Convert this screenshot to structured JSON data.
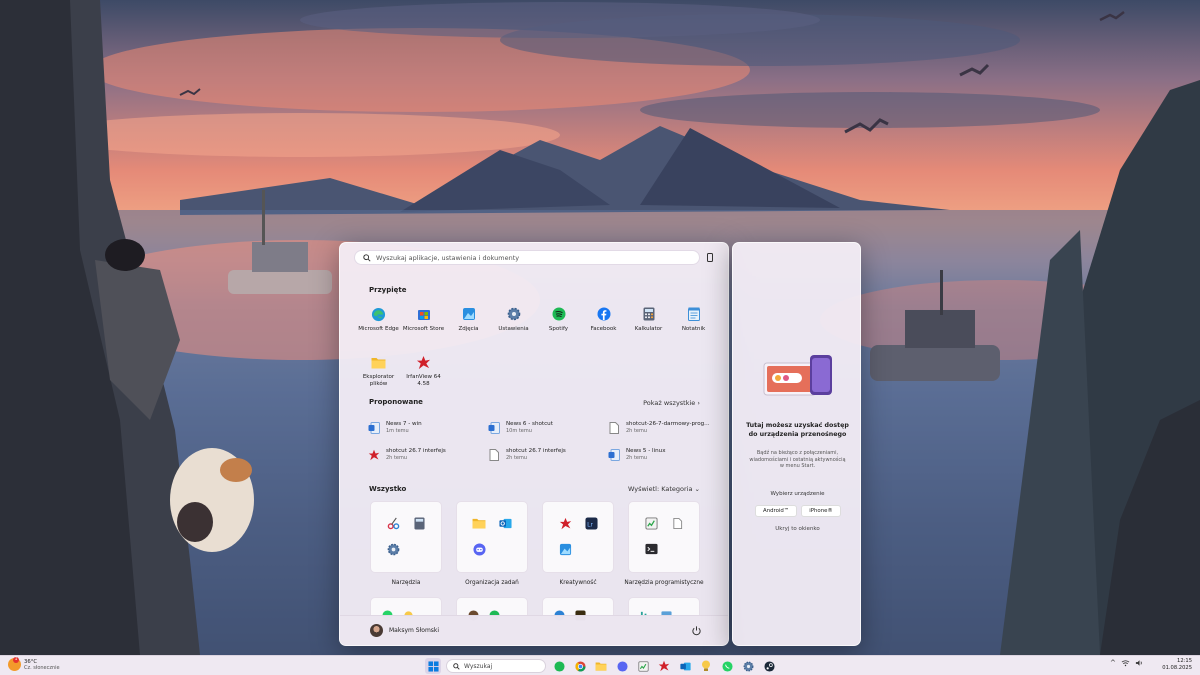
{
  "start_menu": {
    "search_placeholder": "Wyszukaj aplikacje, ustawienia i dokumenty",
    "pinned_title": "Przypięte",
    "pinned": [
      {
        "label": "Microsoft Edge",
        "icon": "edge-icon"
      },
      {
        "label": "Microsoft Store",
        "icon": "store-icon"
      },
      {
        "label": "Zdjęcia",
        "icon": "photos-icon"
      },
      {
        "label": "Ustawienia",
        "icon": "settings-icon"
      },
      {
        "label": "Spotify",
        "icon": "spotify-icon"
      },
      {
        "label": "Facebook",
        "icon": "facebook-icon"
      },
      {
        "label": "Kalkulator",
        "icon": "calculator-icon"
      },
      {
        "label": "Notatnik",
        "icon": "notepad-icon"
      },
      {
        "label": "Eksplorator plików",
        "icon": "folder-icon"
      },
      {
        "label": "IrfanView 64 4.58",
        "icon": "irfanview-icon"
      }
    ],
    "recommended_title": "Proponowane",
    "show_all_label": "Pokaż wszystkie",
    "recommended": [
      {
        "name": "News 7 - win",
        "time": "1m temu",
        "icon": "word-doc-icon"
      },
      {
        "name": "News 6 - shotcut",
        "time": "10m temu",
        "icon": "word-doc-icon"
      },
      {
        "name": "shotcut-26-7-darmowy-prog...",
        "time": "2h temu",
        "icon": "file-icon"
      },
      {
        "name": "shotcut 26.7 interfejs",
        "time": "2h temu",
        "icon": "irfanview-icon"
      },
      {
        "name": "shotcut 26.7 interfejs",
        "time": "2h temu",
        "icon": "file-icon"
      },
      {
        "name": "News 5 - linux",
        "time": "2h temu",
        "icon": "word-doc-icon"
      }
    ],
    "all_title": "Wszystko",
    "view_label": "Wyświetl: Kategoria",
    "categories": [
      {
        "label": "Narzędzia",
        "icons": [
          "snipping-icon",
          "calculator-icon",
          "settings-icon"
        ]
      },
      {
        "label": "Organizacja zadań",
        "icons": [
          "folder-icon",
          "outlook-icon",
          "discord-icon"
        ]
      },
      {
        "label": "Kreatywność",
        "icons": [
          "irfanview-icon",
          "lightroom-icon",
          "photos-icon"
        ]
      },
      {
        "label": "Narzędzia programistyczne",
        "icons": [
          "editor-icon",
          "file-icon",
          "terminal-icon"
        ]
      }
    ],
    "user_name": "Maksym Słomski"
  },
  "phone_panel": {
    "title": "Tutaj możesz uzyskać dostęp do urządzenia przenośnego",
    "description": "Bądź na bieżąco z połączeniami, wiadomościami i ostatnią aktywnością w menu Start.",
    "choose_label": "Wybierz urządzenie",
    "android_label": "Android™",
    "iphone_label": "iPhone®",
    "hide_label": "Ukryj to okienko"
  },
  "taskbar": {
    "weather_temp": "36°C",
    "weather_desc": "Cz. słonecznie",
    "weather_badge": "1",
    "search_placeholder": "Wyszukaj",
    "time": "12:15",
    "date": "01.08.2025"
  },
  "colors": {
    "accent": "#0078d4",
    "spotify": "#1db954",
    "facebook": "#1877f2"
  }
}
